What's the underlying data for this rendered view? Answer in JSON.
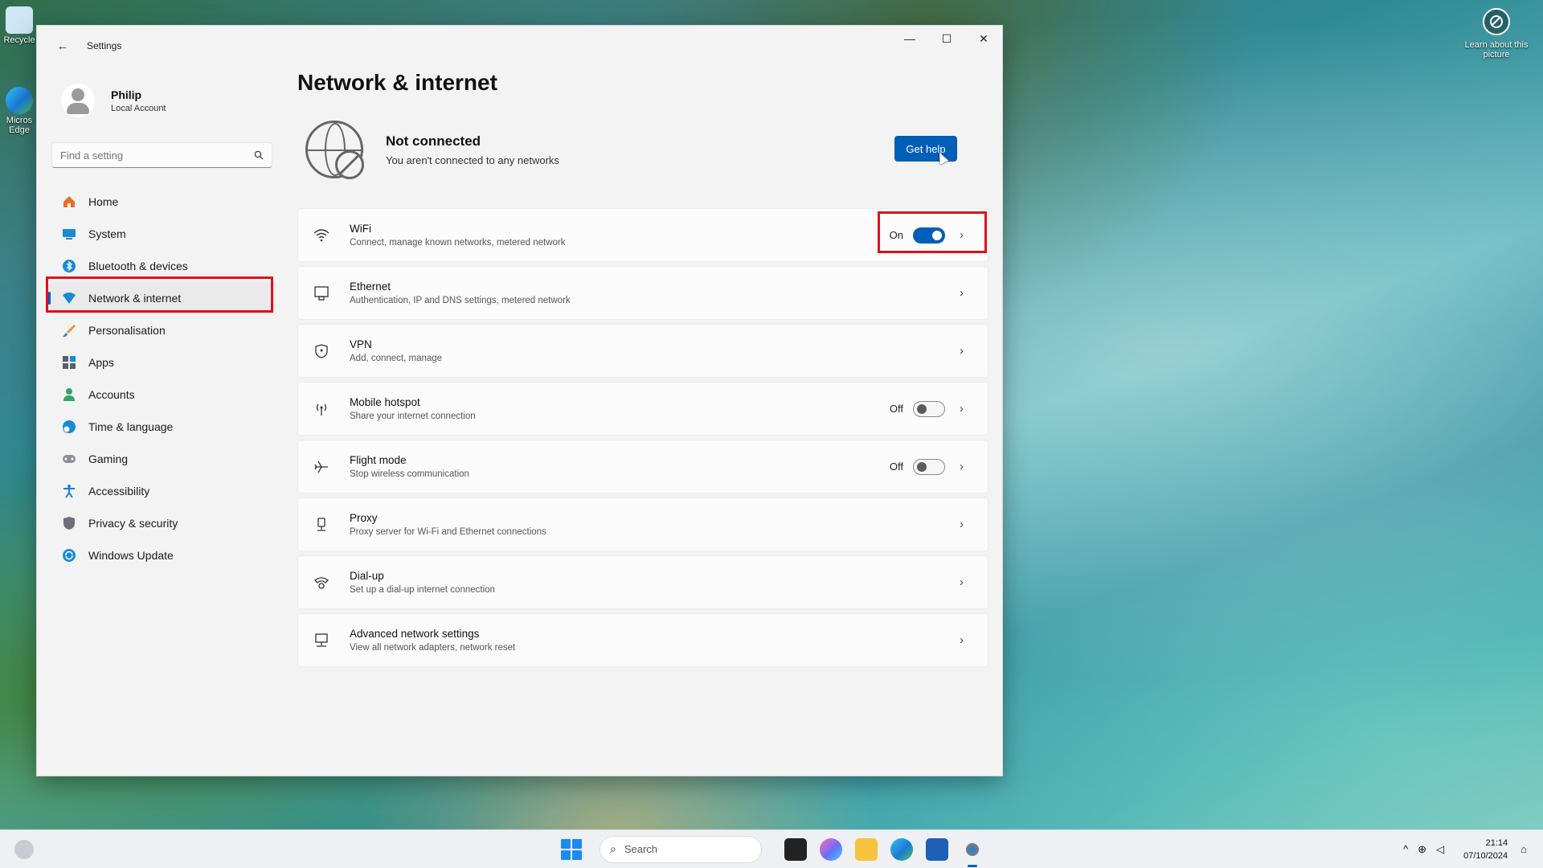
{
  "desktop": {
    "icons": [
      {
        "label": "Recycle"
      },
      {
        "label": "Micros Edge"
      }
    ],
    "learn_about": "Learn about this picture"
  },
  "window": {
    "app_title": "Settings",
    "controls": {
      "minimize": "—",
      "maximize": "☐",
      "close": "✕"
    },
    "profile": {
      "name": "Philip",
      "subtitle": "Local Account"
    },
    "search": {
      "placeholder": "Find a setting"
    },
    "nav": [
      {
        "label": "Home",
        "icon": "home-icon",
        "color": "#e8702a"
      },
      {
        "label": "System",
        "icon": "monitor-icon",
        "color": "#1a8ad4"
      },
      {
        "label": "Bluetooth & devices",
        "icon": "bluetooth-icon",
        "color": "#1a8ad4"
      },
      {
        "label": "Network & internet",
        "icon": "network-icon",
        "color": "#1a8ad4",
        "active": true
      },
      {
        "label": "Personalisation",
        "icon": "brush-icon",
        "color": "#e39536"
      },
      {
        "label": "Apps",
        "icon": "apps-icon",
        "color": "#5b5f6b"
      },
      {
        "label": "Accounts",
        "icon": "account-icon",
        "color": "#2ba86b"
      },
      {
        "label": "Time & language",
        "icon": "globe-clock-icon",
        "color": "#1a8ad4"
      },
      {
        "label": "Gaming",
        "icon": "gamepad-icon",
        "color": "#6b6f7a"
      },
      {
        "label": "Accessibility",
        "icon": "accessibility-icon",
        "color": "#1a7ed4"
      },
      {
        "label": "Privacy & security",
        "icon": "shield-icon",
        "color": "#6b6f7a"
      },
      {
        "label": "Windows Update",
        "icon": "update-icon",
        "color": "#1a8ad4"
      }
    ],
    "page_title": "Network & internet",
    "status": {
      "title": "Not connected",
      "desc": "You aren't connected to any networks",
      "help_button": "Get help"
    },
    "rows": [
      {
        "label": "WiFi",
        "desc": "Connect, manage known networks, metered network",
        "icon": "wifi-icon",
        "state": "On",
        "toggle": "on"
      },
      {
        "label": "Ethernet",
        "desc": "Authentication, IP and DNS settings, metered network",
        "icon": "ethernet-icon"
      },
      {
        "label": "VPN",
        "desc": "Add, connect, manage",
        "icon": "vpn-shield-icon"
      },
      {
        "label": "Mobile hotspot",
        "desc": "Share your internet connection",
        "icon": "hotspot-icon",
        "state": "Off",
        "toggle": "off"
      },
      {
        "label": "Flight mode",
        "desc": "Stop wireless communication",
        "icon": "airplane-icon",
        "state": "Off",
        "toggle": "off"
      },
      {
        "label": "Proxy",
        "desc": "Proxy server for Wi-Fi and Ethernet connections",
        "icon": "proxy-icon"
      },
      {
        "label": "Dial-up",
        "desc": "Set up a dial-up internet connection",
        "icon": "dialup-icon"
      },
      {
        "label": "Advanced network settings",
        "desc": "View all network adapters, network reset",
        "icon": "advanced-network-icon"
      }
    ]
  },
  "taskbar": {
    "search": "Search",
    "time": "21:14",
    "date": "07/10/2024"
  },
  "accent": "#005fb8",
  "highlight": "#e0101e"
}
